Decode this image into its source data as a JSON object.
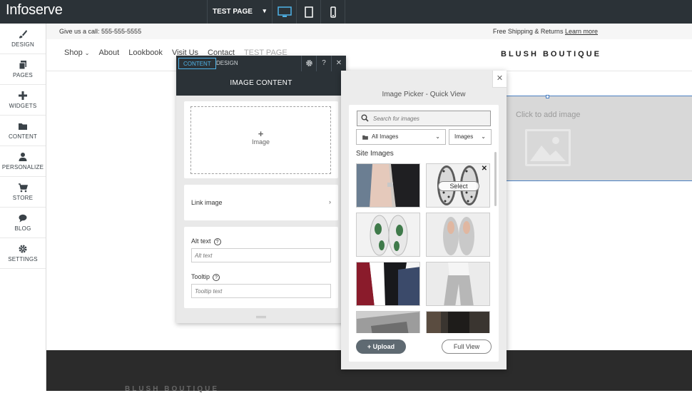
{
  "app": {
    "logo": "Infoserve"
  },
  "toolbar": {
    "page_select": "TEST PAGE"
  },
  "leftnav": {
    "items": [
      {
        "label": "DESIGN",
        "icon": "paintbrush-icon"
      },
      {
        "label": "PAGES",
        "icon": "pages-icon"
      },
      {
        "label": "WIDGETS",
        "icon": "plus-icon"
      },
      {
        "label": "CONTENT",
        "icon": "folder-icon"
      },
      {
        "label": "PERSONALIZE",
        "icon": "person-icon"
      },
      {
        "label": "STORE",
        "icon": "cart-icon"
      },
      {
        "label": "BLOG",
        "icon": "speech-bubble-icon"
      },
      {
        "label": "SETTINGS",
        "icon": "gear-icon"
      }
    ]
  },
  "site": {
    "promo_left": "Give us a call: 555-555-5555",
    "promo_right": "Free Shipping & Returns",
    "promo_link": "Learn more",
    "nav": [
      "Shop",
      "About",
      "Lookbook",
      "Visit Us",
      "Contact",
      "TEST PAGE"
    ],
    "brand": "BLUSH BOUTIQUE",
    "image_placeholder": "Click to add image",
    "footer_brand": "BLUSH BOUTIQUE"
  },
  "panel": {
    "tabs": [
      "CONTENT",
      "DESIGN"
    ],
    "title": "IMAGE CONTENT",
    "image_label": "Image",
    "link_label": "Link image",
    "alt_label": "Alt text",
    "alt_placeholder": "Alt text",
    "tooltip_label": "Tooltip",
    "tooltip_placeholder": "Tooltip text",
    "help_glyph": "?"
  },
  "picker": {
    "title": "Image Picker - Quick View",
    "search_placeholder": "Search for images",
    "filter_all": "All Images",
    "filter_type": "Images",
    "section_label": "Site Images",
    "select_label": "Select",
    "upload_label": "Upload",
    "full_view_label": "Full View"
  },
  "colors": {
    "topbar": "#2b3237",
    "accent": "#4fb3e8",
    "selection": "#4a7fc1",
    "upload_button": "#5f6a72"
  }
}
